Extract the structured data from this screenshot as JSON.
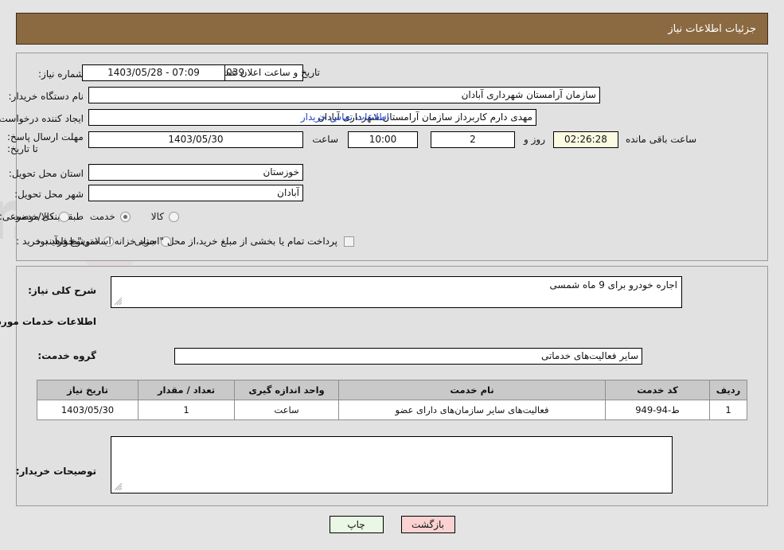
{
  "header": {
    "title": "جزئیات اطلاعات نیاز"
  },
  "colors": {
    "header_bar": "#8b6a41",
    "panel_bg": "#e1e1e1",
    "page_bg": "#e4e4e4",
    "link": "#1f42c8",
    "timer_field": "#fbfbe2",
    "back_button": "#fbd2d2",
    "print_button": "#e9f7e4",
    "table_header": "#c9c9c9"
  },
  "form": {
    "need_number": {
      "label": "شماره نیاز:",
      "value": "1103095019000039"
    },
    "buyer_org": {
      "label": "نام دستگاه خریدار:",
      "value": "سازمان آرامستان شهرداری آبادان"
    },
    "requester": {
      "label": "ایجاد کننده درخواست:",
      "value": "مهدی دارم کاربرداز سازمان آرامستان شهرداری آبادان"
    },
    "deadline": {
      "label": "مهلت ارسال پاسخ: تا تاریخ:",
      "date": "1403/05/30",
      "time_label": "ساعت",
      "time": "10:00",
      "days": "2",
      "days_label": "روز و",
      "countdown": "02:26:28",
      "countdown_label": "ساعت باقی مانده"
    },
    "announce": {
      "label": "تاریخ و ساعت اعلان عمومی:",
      "value": "07:09 - 1403/05/28"
    },
    "contact_link": "اطلاعات تماس خریدار",
    "province": {
      "label": "استان محل تحویل:",
      "value": "خوزستان"
    },
    "city": {
      "label": "شهر محل تحویل:",
      "value": "آبادان"
    },
    "category": {
      "label": "طبقه بندی موضوعی:",
      "options": [
        "کالا",
        "خدمت",
        "کالا/خدمت"
      ],
      "selected": "خدمت"
    },
    "process": {
      "label": "نوع فرآیند خرید :",
      "options": [
        "جزیی",
        "متوسط"
      ],
      "selected": "",
      "checkbox_label": "پرداخت تمام یا بخشی از مبلغ خرید،از محل \"اسناد خزانه اسلامی\" خواهد بود.",
      "checkbox_checked": false
    }
  },
  "need": {
    "summary_label": "شرح کلی نیاز:",
    "summary_value": "اجاره خودرو برای 9 ماه شمسی",
    "services_heading": "اطلاعات خدمات مورد نیاز",
    "service_group_label": "گروه خدمت:",
    "service_group_value": "سایر فعالیت‌های خدماتی"
  },
  "table": {
    "columns": [
      "ردیف",
      "کد خدمت",
      "نام خدمت",
      "واحد اندازه گیری",
      "تعداد / مقدار",
      "تاریخ نیاز"
    ],
    "rows": [
      {
        "row_no": "1",
        "service_code": "ط-94-949",
        "service_name": "فعالیت‌های سایر سازمان‌های دارای عضو",
        "unit": "ساعت",
        "quantity": "1",
        "need_date": "1403/05/30"
      }
    ]
  },
  "remarks": {
    "label": "توصیحات خریدار:",
    "value": ""
  },
  "buttons": {
    "back": "بازگشت",
    "print": "چاپ"
  },
  "watermark": {
    "text": "AriaTender.net"
  }
}
